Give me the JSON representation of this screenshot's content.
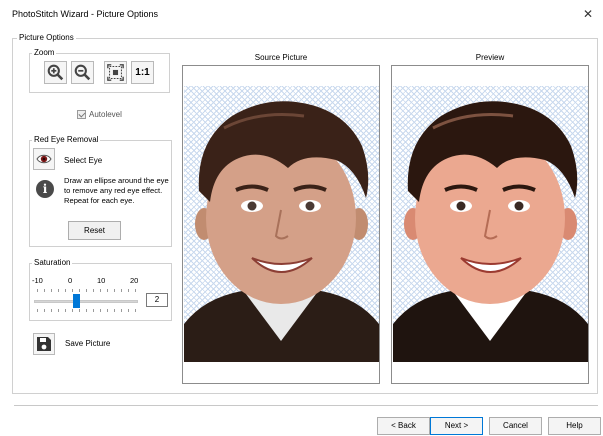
{
  "window": {
    "title": "PhotoStitch Wizard - Picture Options",
    "close_glyph": "✕"
  },
  "picture_options": {
    "group_label": "Picture Options",
    "zoom": {
      "label": "Zoom",
      "buttons": [
        {
          "name": "zoom-in",
          "icon": "zoom-in-icon"
        },
        {
          "name": "zoom-out",
          "icon": "zoom-out-icon"
        },
        {
          "name": "zoom-fit",
          "icon": "zoom-fit-icon"
        },
        {
          "name": "zoom-actual",
          "label": "1:1"
        }
      ]
    },
    "autolevel": {
      "label": "Autolevel",
      "checked": true
    },
    "red_eye": {
      "label": "Red Eye Removal",
      "select_eye_label": "Select Eye",
      "info_text": "Draw an ellipse around the eye to remove any red eye effect. Repeat for each eye.",
      "reset_label": "Reset"
    },
    "saturation": {
      "label": "Saturation",
      "ticks": [
        "-10",
        "0",
        "10",
        "20"
      ],
      "value": "2"
    },
    "save_picture_label": "Save Picture",
    "source_title": "Source Picture",
    "preview_title": "Preview"
  },
  "footer": {
    "back_label": "< Back",
    "next_label": "Next >",
    "cancel_label": "Cancel",
    "help_label": "Help"
  },
  "colors": {
    "accent": "#0078d7",
    "checker": "#c9d9ee"
  }
}
